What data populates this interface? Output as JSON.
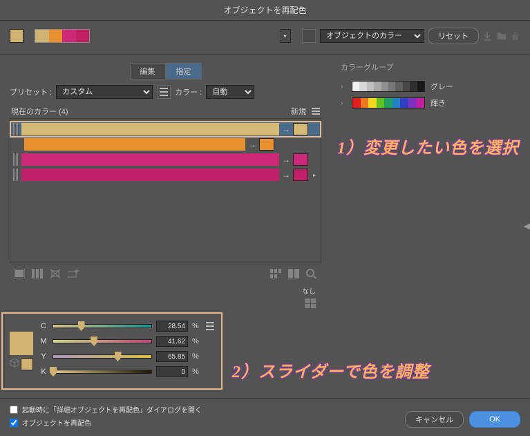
{
  "title": "オブジェクトを再配色",
  "topbar": {
    "active_swatch": "#d0b272",
    "palette": [
      "#d0b272",
      "#e89030",
      "#d02878",
      "#c02060"
    ],
    "dropdown1_label": "オブジェクトのカラー",
    "reset_label": "リセット"
  },
  "tabs": {
    "edit": "編集",
    "assign": "指定"
  },
  "preset": {
    "label": "プリセット :",
    "value": "カスタム"
  },
  "color_count": {
    "label": "カラー :",
    "value": "自動"
  },
  "current_colors": {
    "label": "現在のカラー (4)",
    "new_label": "新規"
  },
  "color_rows": [
    {
      "bar": "#d4b878",
      "target": "#d4b878",
      "selected": true,
      "indent": 0
    },
    {
      "bar": "#e89030",
      "target": "#e89030",
      "selected": false,
      "indent": 1
    },
    {
      "bar": "#d02878",
      "target": "#d02878",
      "selected": false,
      "indent": 0
    },
    {
      "bar": "#c02068",
      "target": "#c02068",
      "selected": false,
      "indent": 0,
      "hasTri": true
    }
  ],
  "sliders": {
    "preview": "#d0b272",
    "channels": [
      {
        "name": "C",
        "value": "28.54",
        "gradient": "linear-gradient(90deg,#d8c088,#209090)"
      },
      {
        "name": "M",
        "value": "41.62",
        "gradient": "linear-gradient(90deg,#c8d888,#c04878)"
      },
      {
        "name": "Y",
        "value": "65.85",
        "gradient": "linear-gradient(90deg,#b098c0,#d8c040)"
      },
      {
        "name": "K",
        "value": "0",
        "gradient": "linear-gradient(90deg,#e0c890,#201808)"
      }
    ],
    "percent": "%"
  },
  "none_label": "なし",
  "color_groups": {
    "header": "カラーグループ",
    "items": [
      {
        "label": "グレー",
        "colors": [
          "#f0f0f0",
          "#d8d8d8",
          "#c0c0c0",
          "#a8a8a8",
          "#909090",
          "#787878",
          "#606060",
          "#484848",
          "#303030",
          "#181818"
        ]
      },
      {
        "label": "輝き",
        "colors": [
          "#e02020",
          "#f07820",
          "#f0d820",
          "#60c020",
          "#20a060",
          "#2080c0",
          "#3040c0",
          "#8030c0",
          "#c020a0"
        ]
      }
    ]
  },
  "annotations": {
    "a1": "1）変更したい色を選択",
    "a2": "2）スライダーで色を調整"
  },
  "footer": {
    "chk1": "起動時に「詳細オブジェクトを再配色」ダイアログを開く",
    "chk2": "オブジェクトを再配色",
    "cancel": "キャンセル",
    "ok": "OK"
  }
}
